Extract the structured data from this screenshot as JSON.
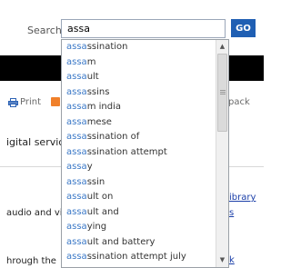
{
  "header": {
    "search_label": "Search",
    "search_value": "assa",
    "go_label": "GO"
  },
  "toolbar": {
    "print_label": "Print",
    "rss_fragment": "S",
    "feedback_fragment": "pack"
  },
  "page_fragments": {
    "digital_services": "igital service",
    "audio_text": "audio and vid",
    "through_text": "hrough the",
    "library_link": "ibrary",
    "s_link": "s",
    "k_link": "k"
  },
  "autocomplete": {
    "query": "assa",
    "suggestions": [
      {
        "match": "assa",
        "rest": "ssination"
      },
      {
        "match": "assa",
        "rest": "m"
      },
      {
        "match": "assa",
        "rest": "ult"
      },
      {
        "match": "assa",
        "rest": "ssins"
      },
      {
        "match": "assa",
        "rest": "m india"
      },
      {
        "match": "assa",
        "rest": "mese"
      },
      {
        "match": "assa",
        "rest": "ssination of"
      },
      {
        "match": "assa",
        "rest": "ssination attempt"
      },
      {
        "match": "assa",
        "rest": "y"
      },
      {
        "match": "assa",
        "rest": "ssin"
      },
      {
        "match": "assa",
        "rest": "ult on"
      },
      {
        "match": "assa",
        "rest": "ult and"
      },
      {
        "match": "assa",
        "rest": "ying"
      },
      {
        "match": "assa",
        "rest": "ult and battery"
      },
      {
        "match": "assa",
        "rest": "ssination attempt july"
      }
    ]
  },
  "colors": {
    "go_button": "#1f5fb3",
    "match_text": "#3a78c7",
    "link": "#1a3ea8",
    "top_bar": "#000000"
  }
}
